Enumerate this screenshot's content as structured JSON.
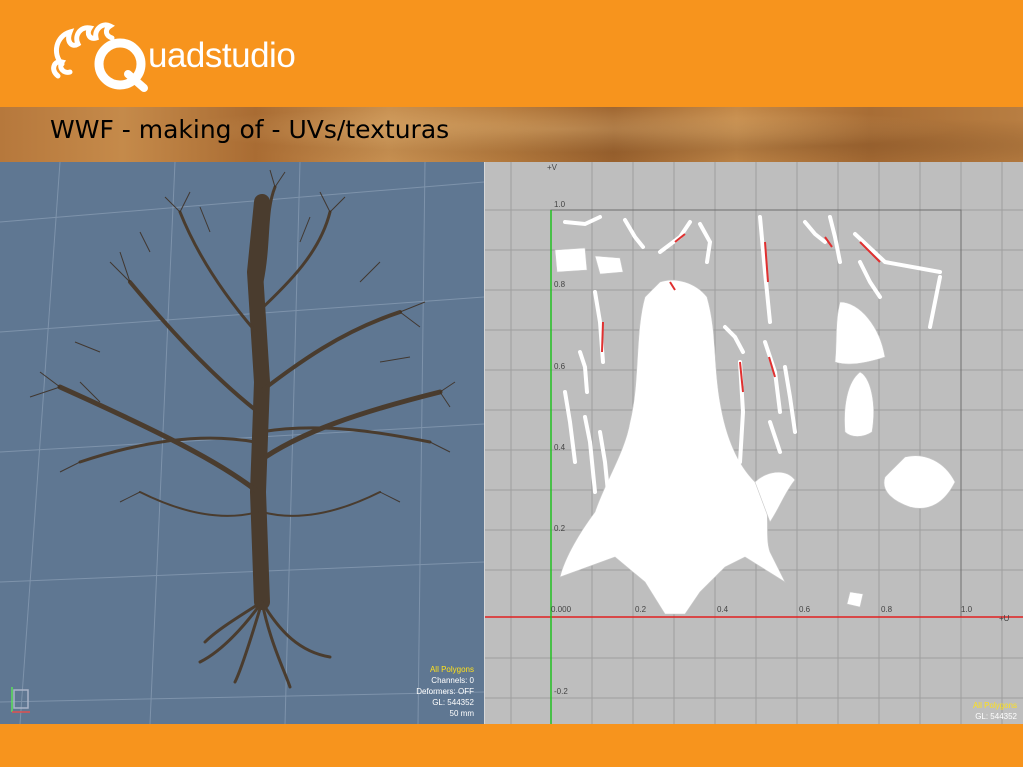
{
  "logo": {
    "text": "uadstudio"
  },
  "banner": {
    "title": "WWF - making of - UVs/texturas"
  },
  "viewport3d": {
    "hud": {
      "mode": "All Polygons",
      "channels": "Channels: 0",
      "deformers": "Deformers: OFF",
      "gl": "GL: 544352",
      "lens": "50 mm"
    }
  },
  "uv_editor": {
    "v_axis_label": "+V",
    "u_axis_label": "+U",
    "v_ticks": [
      "1.0",
      "0.8",
      "0.6",
      "0.4",
      "0.2",
      "-0.2"
    ],
    "u_ticks": [
      "0.000",
      "0.2",
      "0.4",
      "0.6",
      "0.8",
      "1.0"
    ],
    "hud": {
      "mode": "All Polygons",
      "gl": "GL: 544352"
    }
  },
  "colors": {
    "brand_orange": "#f7941d",
    "viewport_bg": "#5f7792",
    "uv_bg": "#bebebe",
    "u_axis": "#e02020",
    "v_axis": "#20c020",
    "uv_highlight": "#e03030"
  }
}
